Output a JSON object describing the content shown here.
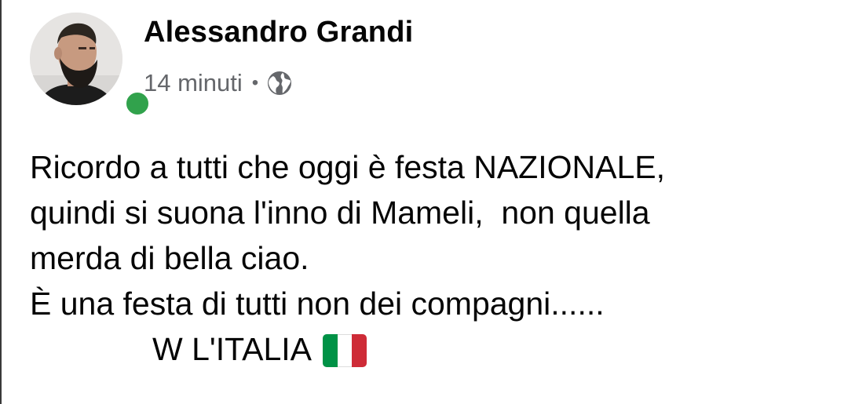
{
  "post": {
    "author": "Alessandro Grandi",
    "timestamp": "14 minuti",
    "separator": "•",
    "audience_icon": "globe-icon",
    "online_status_color": "#31a24c",
    "lines": [
      "Ricordo a tutti che oggi è festa NAZIONALE,",
      "quindi si suona l'inno di Mameli,  non quella",
      "merda di bella ciao.",
      "È una festa di tutti non dei compagni......"
    ],
    "closing": "W L'ITALIA",
    "closing_icon": "italian-flag-icon",
    "flag_colors": [
      "#009246",
      "#ffffff",
      "#ce2b37"
    ]
  }
}
